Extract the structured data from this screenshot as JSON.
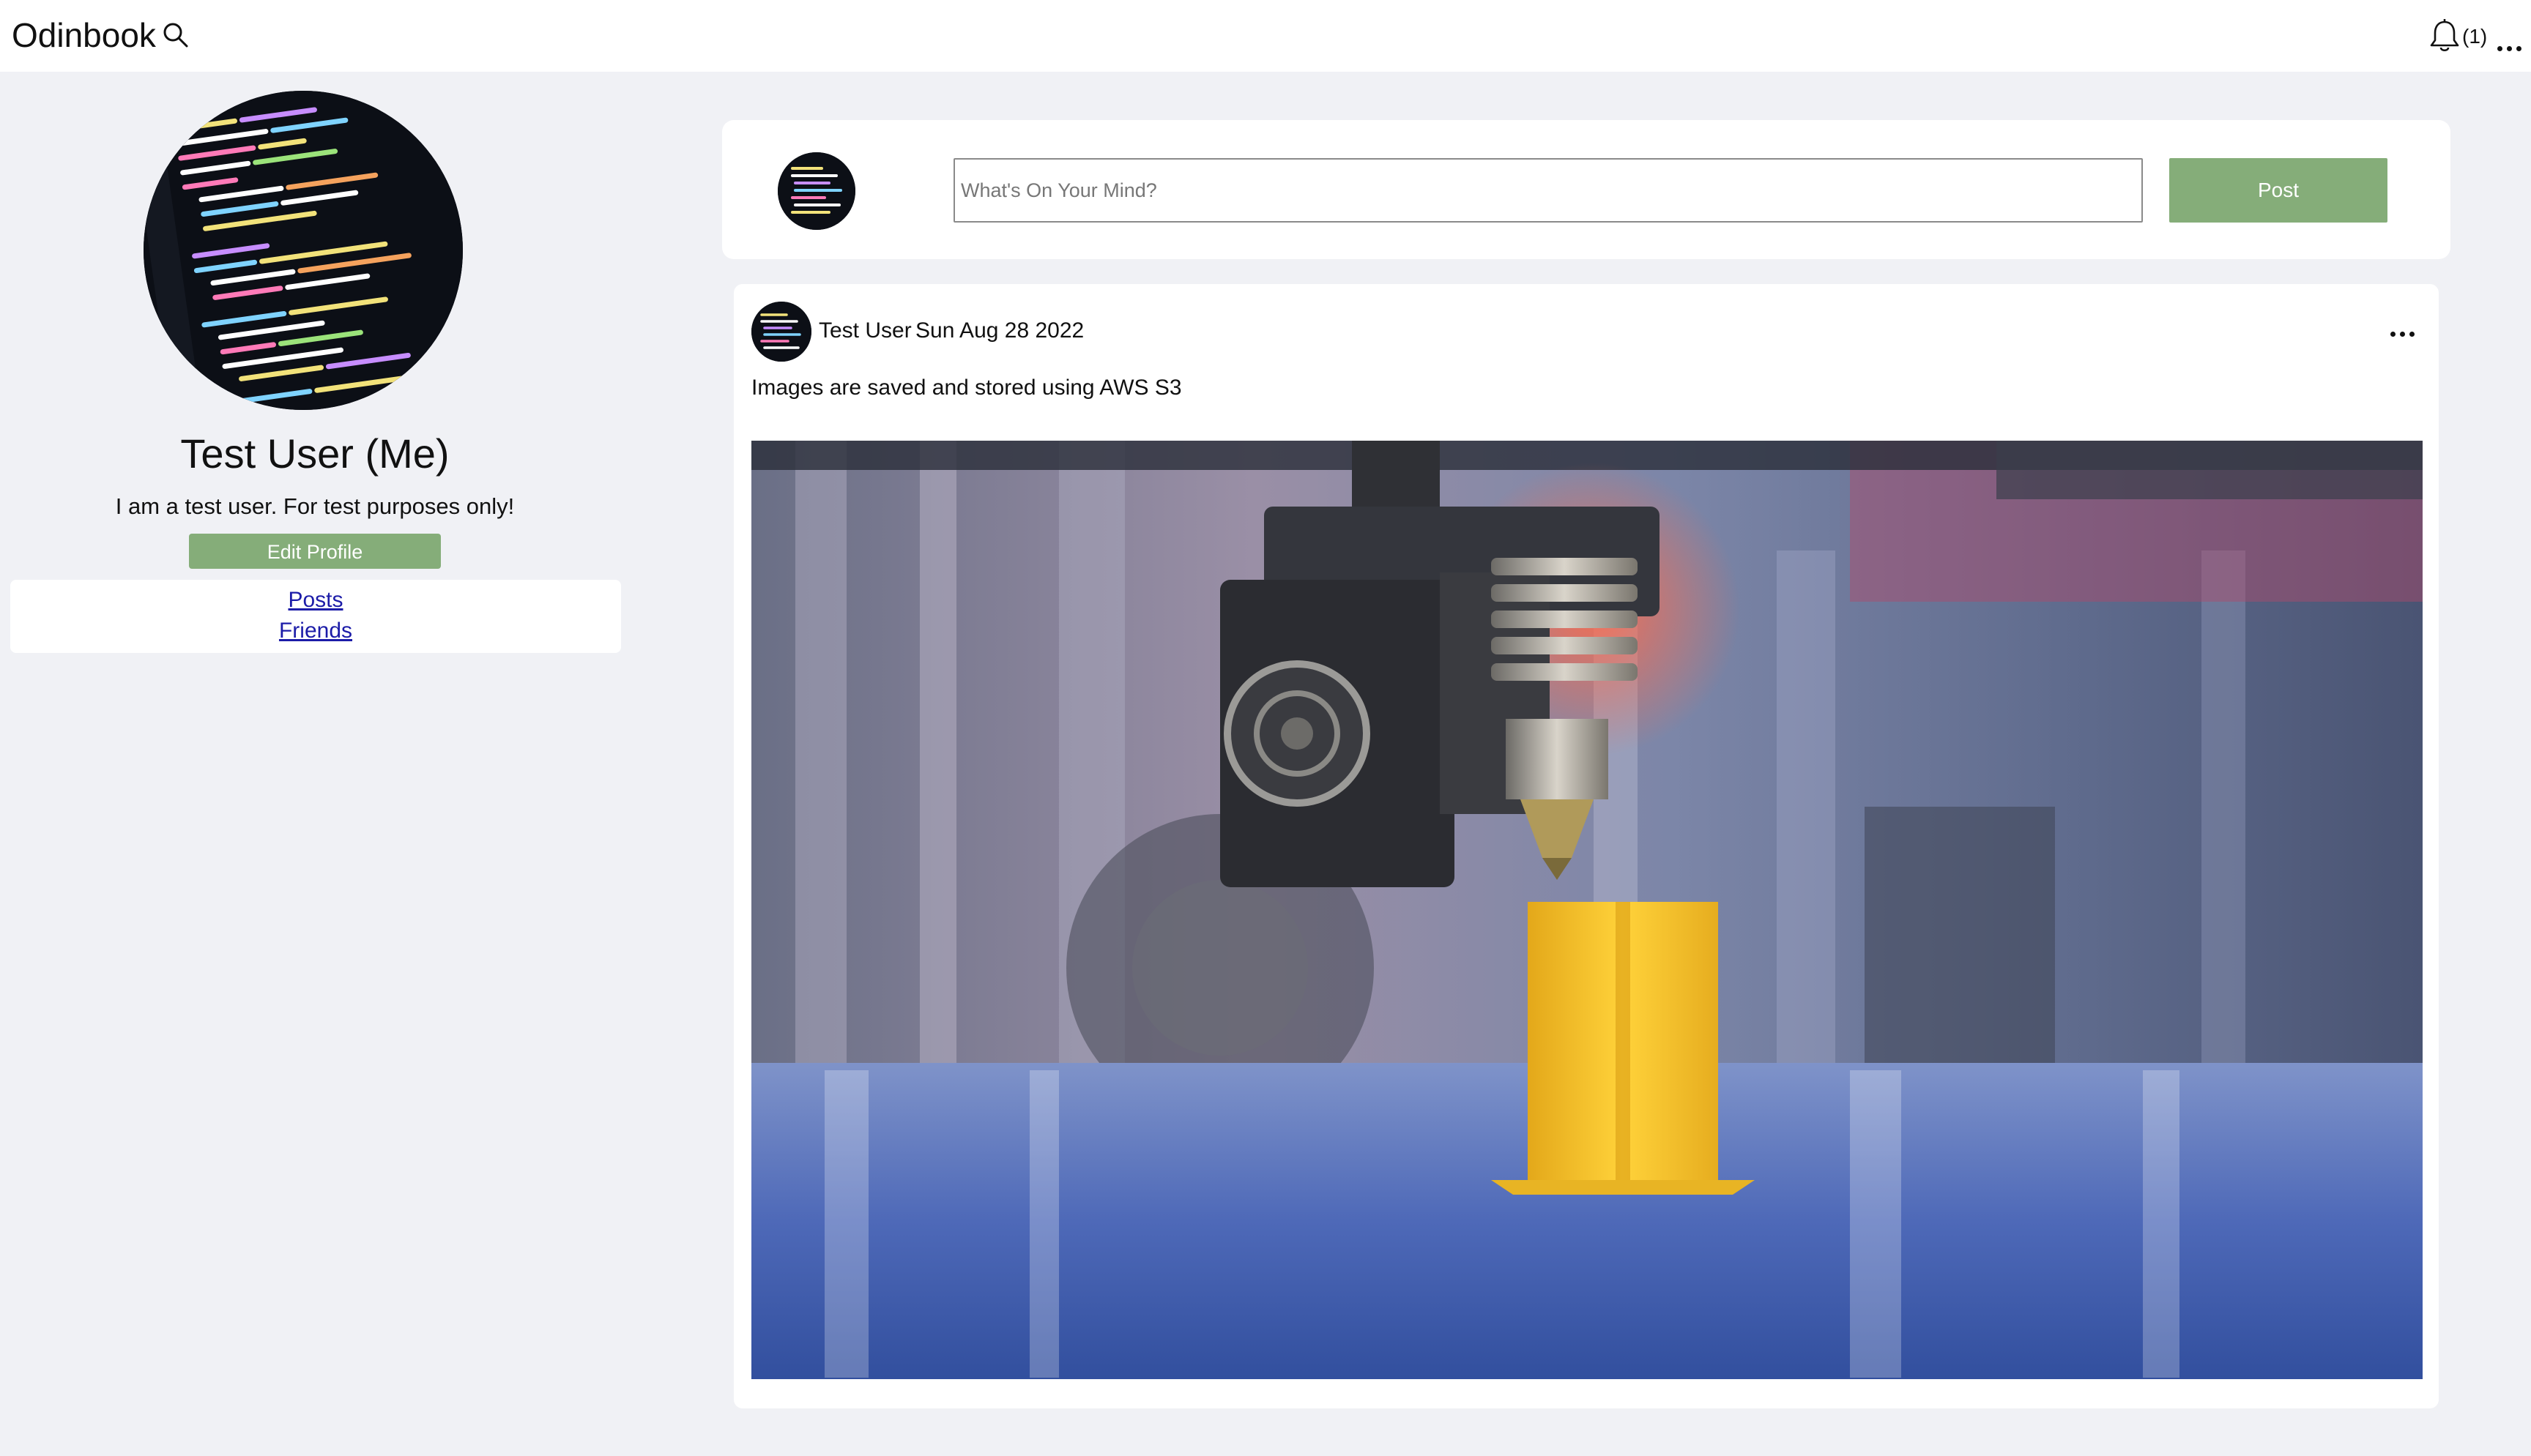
{
  "app": {
    "brand": "Odinbook"
  },
  "nav": {
    "notification_count": "(1)",
    "icons": {
      "search": "search-icon",
      "notifications": "bell-icon",
      "more": "more-dots-icon"
    }
  },
  "profile": {
    "name": "Test User (Me)",
    "bio": "I am a test user. For test purposes only!",
    "edit_label": "Edit Profile",
    "links": {
      "posts": "Posts",
      "friends": "Friends"
    }
  },
  "composer": {
    "placeholder": "What's On Your Mind?",
    "post_label": "Post"
  },
  "post": {
    "author": "Test User",
    "date": "Sun Aug 28 2022",
    "text": "Images are saved and stored using AWS S3"
  },
  "colors": {
    "accent_green": "#85ad79",
    "page_background": "#f0f1f5",
    "link": "#1c1ca8"
  }
}
